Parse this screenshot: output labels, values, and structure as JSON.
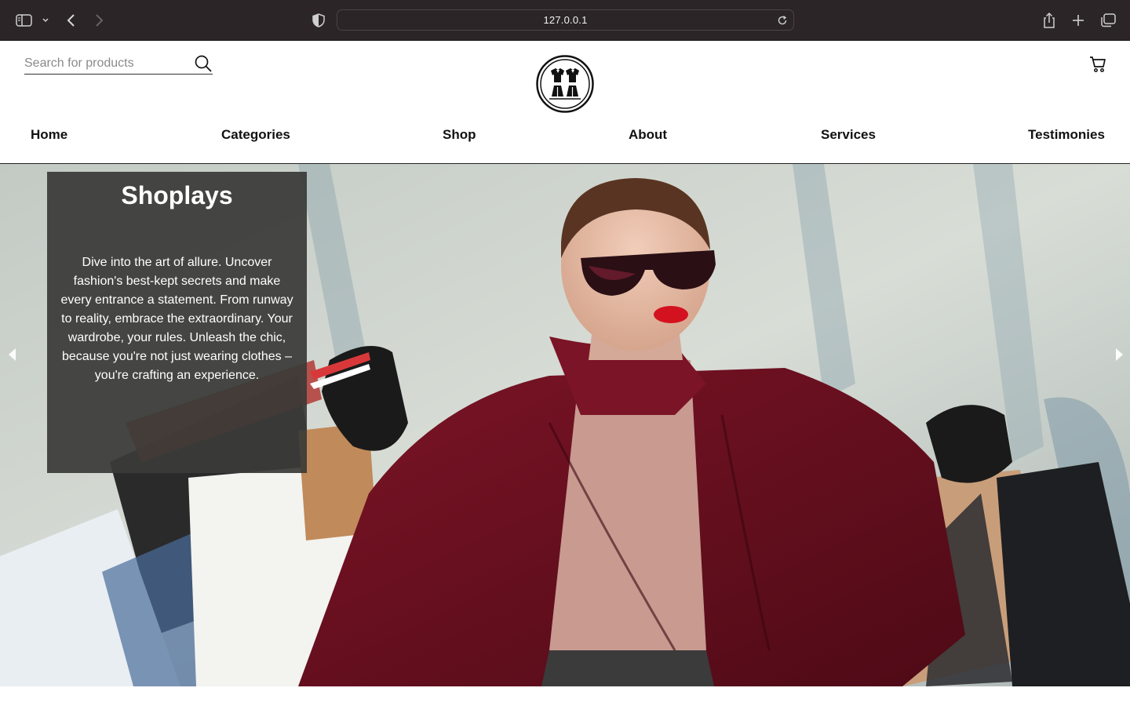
{
  "browser": {
    "url": "127.0.0.1",
    "icons": [
      "sidebar-icon",
      "chevron-down-icon",
      "back-icon",
      "forward-icon",
      "shield-icon",
      "reload-icon",
      "share-icon",
      "plus-icon",
      "tabs-icon"
    ]
  },
  "header": {
    "search_placeholder": "Search for products",
    "search_value": "",
    "logo_icon": "brand-logo-icon",
    "cart_icon": "cart-icon"
  },
  "nav": {
    "items": [
      {
        "label": "Home"
      },
      {
        "label": "Categories"
      },
      {
        "label": "Shop"
      },
      {
        "label": "About"
      },
      {
        "label": "Services"
      },
      {
        "label": "Testimonies"
      }
    ]
  },
  "hero": {
    "title": "Shoplays",
    "text": "Dive into the art of allure. Uncover fashion's best-kept secrets and make every entrance a statement. From runway to reality, embrace the extraordinary. Your wardrobe, your rules. Unleash the chic, because you're not just wearing clothes – you're crafting an experience.",
    "prev_icon": "chevron-left-icon",
    "next_icon": "chevron-right-icon"
  },
  "colors": {
    "chrome_bg": "#2b2527",
    "card_bg": "#3a3a38",
    "coat": "#6a1020"
  }
}
